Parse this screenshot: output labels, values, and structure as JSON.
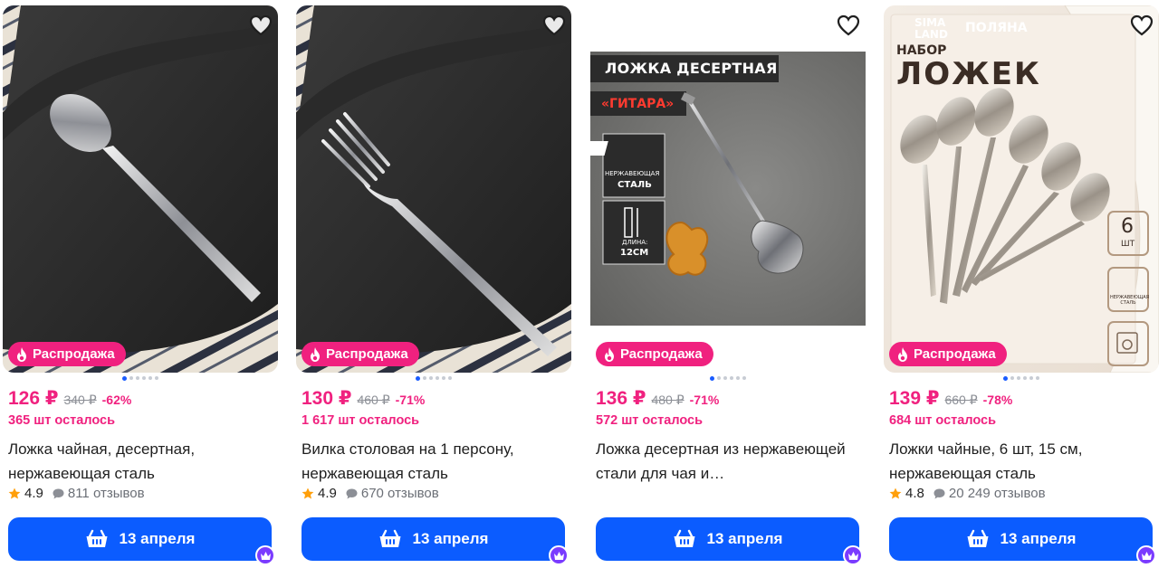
{
  "currency": "₽",
  "sale_badge_label": "Распродажа",
  "delivery_label": "13 апреля",
  "products": [
    {
      "price": "126 ₽",
      "old_price": "340 ₽",
      "discount": "-62%",
      "stock_left": "365 шт осталось",
      "title": "Ложка чайная, десертная, нержавеющая сталь",
      "rating": "4.9",
      "reviews": "811 отзывов"
    },
    {
      "price": "130 ₽",
      "old_price": "460 ₽",
      "discount": "-71%",
      "stock_left": "1 617 шт осталось",
      "title": "Вилка столовая на 1 персону, нержавеющая сталь",
      "rating": "4.9",
      "reviews": "670 отзывов"
    },
    {
      "price": "136 ₽",
      "old_price": "480 ₽",
      "discount": "-71%",
      "stock_left": "572 шт осталось",
      "title": "Ложка десертная из нержавеющей стали для чая и…",
      "image_text": {
        "headline": "ЛОЖКА ДЕСЕРТНАЯ",
        "subtitle": "«ГИТАРА»",
        "material_line1": "НЕРЖАВЕЮЩАЯ",
        "material_line2": "СТАЛЬ",
        "length_line1": "ДЛИНА:",
        "length_line2": "12СМ"
      }
    },
    {
      "price": "139 ₽",
      "old_price": "660 ₽",
      "discount": "-78%",
      "stock_left": "684 шт осталось",
      "title": "Ложки чайные, 6 шт, 15 см, нержавеющая сталь",
      "rating": "4.8",
      "reviews": "20 249 отзывов",
      "image_text": {
        "brand_line1": "SIMA",
        "brand_line2": "LAND",
        "brand_right": "ПОЛЯНА",
        "headline_small": "НАБОР",
        "headline_big": "ЛОЖЕК",
        "count_number": "6",
        "count_unit": "ШТ",
        "material_label": "НЕРЖАВЕЮЩАЯ СТАЛЬ"
      }
    }
  ],
  "colors": {
    "accent_pink": "#f0217f",
    "button_blue": "#0b5cff",
    "star": "#ff9f0a",
    "crown_purple": "#7a3bff"
  },
  "icons": [
    "heart-icon",
    "flame-icon",
    "star-icon",
    "comment-icon",
    "basket-icon",
    "crown-icon"
  ]
}
